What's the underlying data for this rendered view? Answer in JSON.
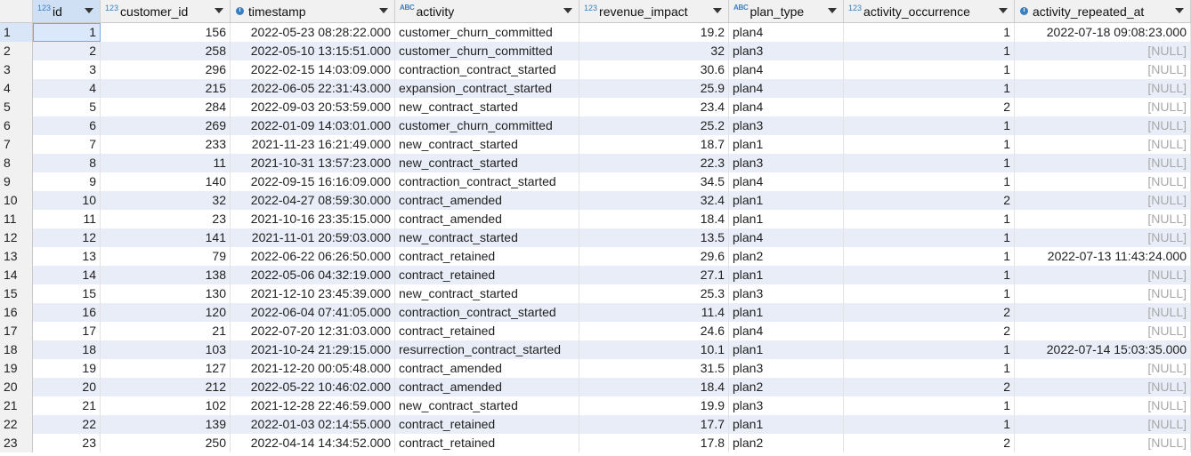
{
  "colors": {
    "accent": "#3a7fc1",
    "row_alt": "#e8edf7",
    "null_text": "#a8a8a8"
  },
  "null_label": "[NULL]",
  "columns": [
    {
      "name": "id",
      "type_icon": "123",
      "type": "numeric",
      "align": "right"
    },
    {
      "name": "customer_id",
      "type_icon": "123",
      "type": "numeric",
      "align": "right"
    },
    {
      "name": "timestamp",
      "type_icon": "clock",
      "type": "datetime",
      "align": "right"
    },
    {
      "name": "activity",
      "type_icon": "ABC",
      "type": "text",
      "align": "left"
    },
    {
      "name": "revenue_impact",
      "type_icon": "123",
      "type": "numeric",
      "align": "right"
    },
    {
      "name": "plan_type",
      "type_icon": "ABC",
      "type": "text",
      "align": "left"
    },
    {
      "name": "activity_occurrence",
      "type_icon": "123",
      "type": "numeric",
      "align": "right"
    },
    {
      "name": "activity_repeated_at",
      "type_icon": "clock",
      "type": "datetime",
      "align": "right"
    }
  ],
  "rows": [
    {
      "n": "1",
      "cells": [
        "1",
        "156",
        "2022-05-23 08:28:22.000",
        "customer_churn_committed",
        "19.2",
        "plan4",
        "1",
        "2022-07-18 09:08:23.000"
      ]
    },
    {
      "n": "2",
      "cells": [
        "2",
        "258",
        "2022-05-10 13:15:51.000",
        "customer_churn_committed",
        "32",
        "plan3",
        "1",
        null
      ]
    },
    {
      "n": "3",
      "cells": [
        "3",
        "296",
        "2022-02-15 14:03:09.000",
        "contraction_contract_started",
        "30.6",
        "plan4",
        "1",
        null
      ]
    },
    {
      "n": "4",
      "cells": [
        "4",
        "215",
        "2022-06-05 22:31:43.000",
        "expansion_contract_started",
        "25.9",
        "plan4",
        "1",
        null
      ]
    },
    {
      "n": "5",
      "cells": [
        "5",
        "284",
        "2022-09-03 20:53:59.000",
        "new_contract_started",
        "23.4",
        "plan4",
        "2",
        null
      ]
    },
    {
      "n": "6",
      "cells": [
        "6",
        "269",
        "2022-01-09 14:03:01.000",
        "customer_churn_committed",
        "25.2",
        "plan3",
        "1",
        null
      ]
    },
    {
      "n": "7",
      "cells": [
        "7",
        "233",
        "2021-11-23 16:21:49.000",
        "new_contract_started",
        "18.7",
        "plan1",
        "1",
        null
      ]
    },
    {
      "n": "8",
      "cells": [
        "8",
        "11",
        "2021-10-31 13:57:23.000",
        "new_contract_started",
        "22.3",
        "plan3",
        "1",
        null
      ]
    },
    {
      "n": "9",
      "cells": [
        "9",
        "140",
        "2022-09-15 16:16:09.000",
        "contraction_contract_started",
        "34.5",
        "plan4",
        "1",
        null
      ]
    },
    {
      "n": "10",
      "cells": [
        "10",
        "32",
        "2022-04-27 08:59:30.000",
        "contract_amended",
        "32.4",
        "plan1",
        "2",
        null
      ]
    },
    {
      "n": "11",
      "cells": [
        "11",
        "23",
        "2021-10-16 23:35:15.000",
        "contract_amended",
        "18.4",
        "plan1",
        "1",
        null
      ]
    },
    {
      "n": "12",
      "cells": [
        "12",
        "141",
        "2021-11-01 20:59:03.000",
        "new_contract_started",
        "13.5",
        "plan4",
        "1",
        null
      ]
    },
    {
      "n": "13",
      "cells": [
        "13",
        "79",
        "2022-06-22 06:26:50.000",
        "contract_retained",
        "29.6",
        "plan2",
        "1",
        "2022-07-13 11:43:24.000"
      ]
    },
    {
      "n": "14",
      "cells": [
        "14",
        "138",
        "2022-05-06 04:32:19.000",
        "contract_retained",
        "27.1",
        "plan1",
        "1",
        null
      ]
    },
    {
      "n": "15",
      "cells": [
        "15",
        "130",
        "2021-12-10 23:45:39.000",
        "new_contract_started",
        "25.3",
        "plan3",
        "1",
        null
      ]
    },
    {
      "n": "16",
      "cells": [
        "16",
        "120",
        "2022-06-04 07:41:05.000",
        "contraction_contract_started",
        "11.4",
        "plan1",
        "2",
        null
      ]
    },
    {
      "n": "17",
      "cells": [
        "17",
        "21",
        "2022-07-20 12:31:03.000",
        "contract_retained",
        "24.6",
        "plan4",
        "2",
        null
      ]
    },
    {
      "n": "18",
      "cells": [
        "18",
        "103",
        "2021-10-24 21:29:15.000",
        "resurrection_contract_started",
        "10.1",
        "plan1",
        "1",
        "2022-07-14 15:03:35.000"
      ]
    },
    {
      "n": "19",
      "cells": [
        "19",
        "127",
        "2021-12-20 00:05:48.000",
        "contract_amended",
        "31.5",
        "plan3",
        "1",
        null
      ]
    },
    {
      "n": "20",
      "cells": [
        "20",
        "212",
        "2022-05-22 10:46:02.000",
        "contract_amended",
        "18.4",
        "plan2",
        "2",
        null
      ]
    },
    {
      "n": "21",
      "cells": [
        "21",
        "102",
        "2021-12-28 22:46:59.000",
        "new_contract_started",
        "19.9",
        "plan3",
        "1",
        null
      ]
    },
    {
      "n": "22",
      "cells": [
        "22",
        "139",
        "2022-01-03 02:14:55.000",
        "contract_retained",
        "17.7",
        "plan1",
        "1",
        null
      ]
    },
    {
      "n": "23",
      "cells": [
        "23",
        "250",
        "2022-04-14 14:34:52.000",
        "contract_retained",
        "17.8",
        "plan2",
        "2",
        null
      ]
    }
  ]
}
